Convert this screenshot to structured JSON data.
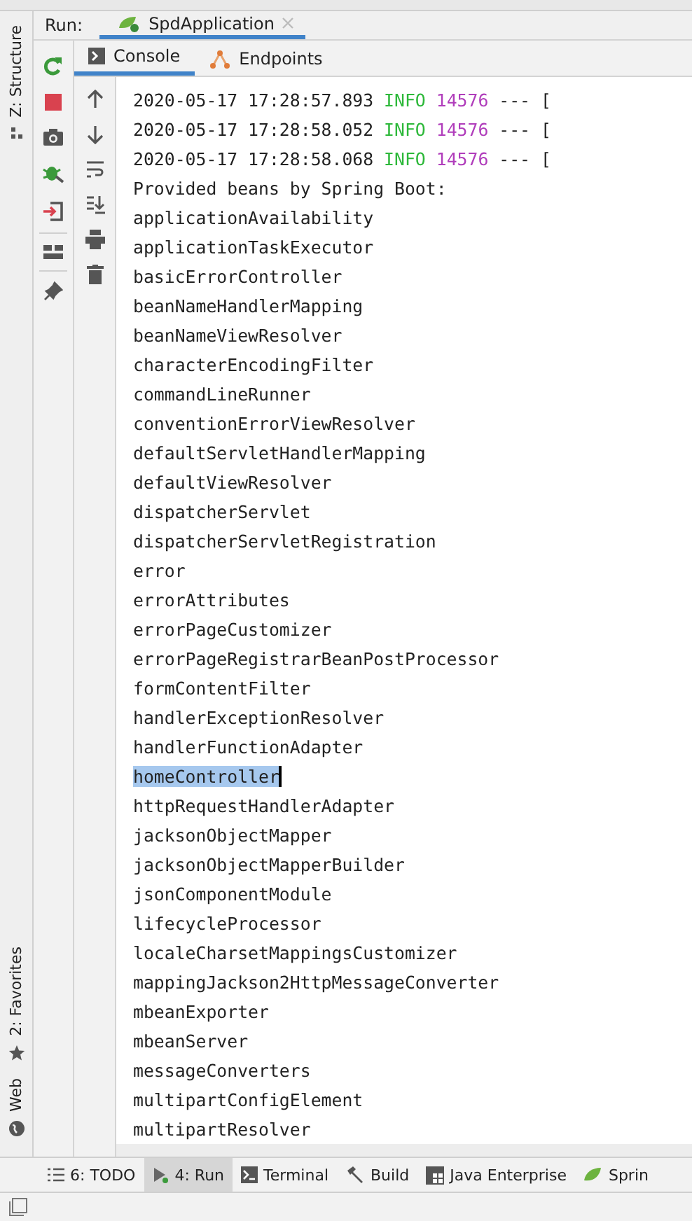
{
  "run_bar": {
    "label": "Run:",
    "tab": {
      "title": "SpdApplication",
      "selected": true
    }
  },
  "left_strip": {
    "top": [
      {
        "label": "Z: Structure"
      }
    ],
    "bottom": [
      {
        "label": "2: Favorites"
      },
      {
        "label": "Web"
      }
    ]
  },
  "console_tabs": [
    {
      "label": "Console",
      "selected": true
    },
    {
      "label": "Endpoints",
      "selected": false
    }
  ],
  "console": {
    "lines": [
      {
        "kind": "log",
        "time": "2020-05-17 17:28:57.893",
        "level": "INFO",
        "pid": "14576",
        "rest": "--- ["
      },
      {
        "kind": "log",
        "time": "2020-05-17 17:28:58.052",
        "level": "INFO",
        "pid": "14576",
        "rest": "--- ["
      },
      {
        "kind": "log",
        "time": "2020-05-17 17:28:58.068",
        "level": "INFO",
        "pid": "14576",
        "rest": "--- ["
      },
      {
        "kind": "text",
        "text": "Provided beans by Spring Boot:",
        "selected": false
      },
      {
        "kind": "text",
        "text": "applicationAvailability",
        "selected": false
      },
      {
        "kind": "text",
        "text": "applicationTaskExecutor",
        "selected": false
      },
      {
        "kind": "text",
        "text": "basicErrorController",
        "selected": false
      },
      {
        "kind": "text",
        "text": "beanNameHandlerMapping",
        "selected": false
      },
      {
        "kind": "text",
        "text": "beanNameViewResolver",
        "selected": false
      },
      {
        "kind": "text",
        "text": "characterEncodingFilter",
        "selected": false
      },
      {
        "kind": "text",
        "text": "commandLineRunner",
        "selected": false
      },
      {
        "kind": "text",
        "text": "conventionErrorViewResolver",
        "selected": false
      },
      {
        "kind": "text",
        "text": "defaultServletHandlerMapping",
        "selected": false
      },
      {
        "kind": "text",
        "text": "defaultViewResolver",
        "selected": false
      },
      {
        "kind": "text",
        "text": "dispatcherServlet",
        "selected": false
      },
      {
        "kind": "text",
        "text": "dispatcherServletRegistration",
        "selected": false
      },
      {
        "kind": "text",
        "text": "error",
        "selected": false
      },
      {
        "kind": "text",
        "text": "errorAttributes",
        "selected": false
      },
      {
        "kind": "text",
        "text": "errorPageCustomizer",
        "selected": false
      },
      {
        "kind": "text",
        "text": "errorPageRegistrarBeanPostProcessor",
        "selected": false
      },
      {
        "kind": "text",
        "text": "formContentFilter",
        "selected": false
      },
      {
        "kind": "text",
        "text": "handlerExceptionResolver",
        "selected": false
      },
      {
        "kind": "text",
        "text": "handlerFunctionAdapter",
        "selected": false
      },
      {
        "kind": "text",
        "text": "homeController",
        "selected": true
      },
      {
        "kind": "text",
        "text": "httpRequestHandlerAdapter",
        "selected": false
      },
      {
        "kind": "text",
        "text": "jacksonObjectMapper",
        "selected": false
      },
      {
        "kind": "text",
        "text": "jacksonObjectMapperBuilder",
        "selected": false
      },
      {
        "kind": "text",
        "text": "jsonComponentModule",
        "selected": false
      },
      {
        "kind": "text",
        "text": "lifecycleProcessor",
        "selected": false
      },
      {
        "kind": "text",
        "text": "localeCharsetMappingsCustomizer",
        "selected": false
      },
      {
        "kind": "text",
        "text": "mappingJackson2HttpMessageConverter",
        "selected": false
      },
      {
        "kind": "text",
        "text": "mbeanExporter",
        "selected": false
      },
      {
        "kind": "text",
        "text": "mbeanServer",
        "selected": false
      },
      {
        "kind": "text",
        "text": "messageConverters",
        "selected": false
      },
      {
        "kind": "text",
        "text": "multipartConfigElement",
        "selected": false
      },
      {
        "kind": "text",
        "text": "multipartResolver",
        "selected": false
      }
    ]
  },
  "bottom_tabs": [
    {
      "label": "6: TODO",
      "selected": false
    },
    {
      "label": "4: Run",
      "selected": true
    },
    {
      "label": "Terminal",
      "selected": false
    },
    {
      "label": "Build",
      "selected": false
    },
    {
      "label": "Java Enterprise",
      "selected": false
    },
    {
      "label": "Sprin",
      "selected": false
    }
  ]
}
